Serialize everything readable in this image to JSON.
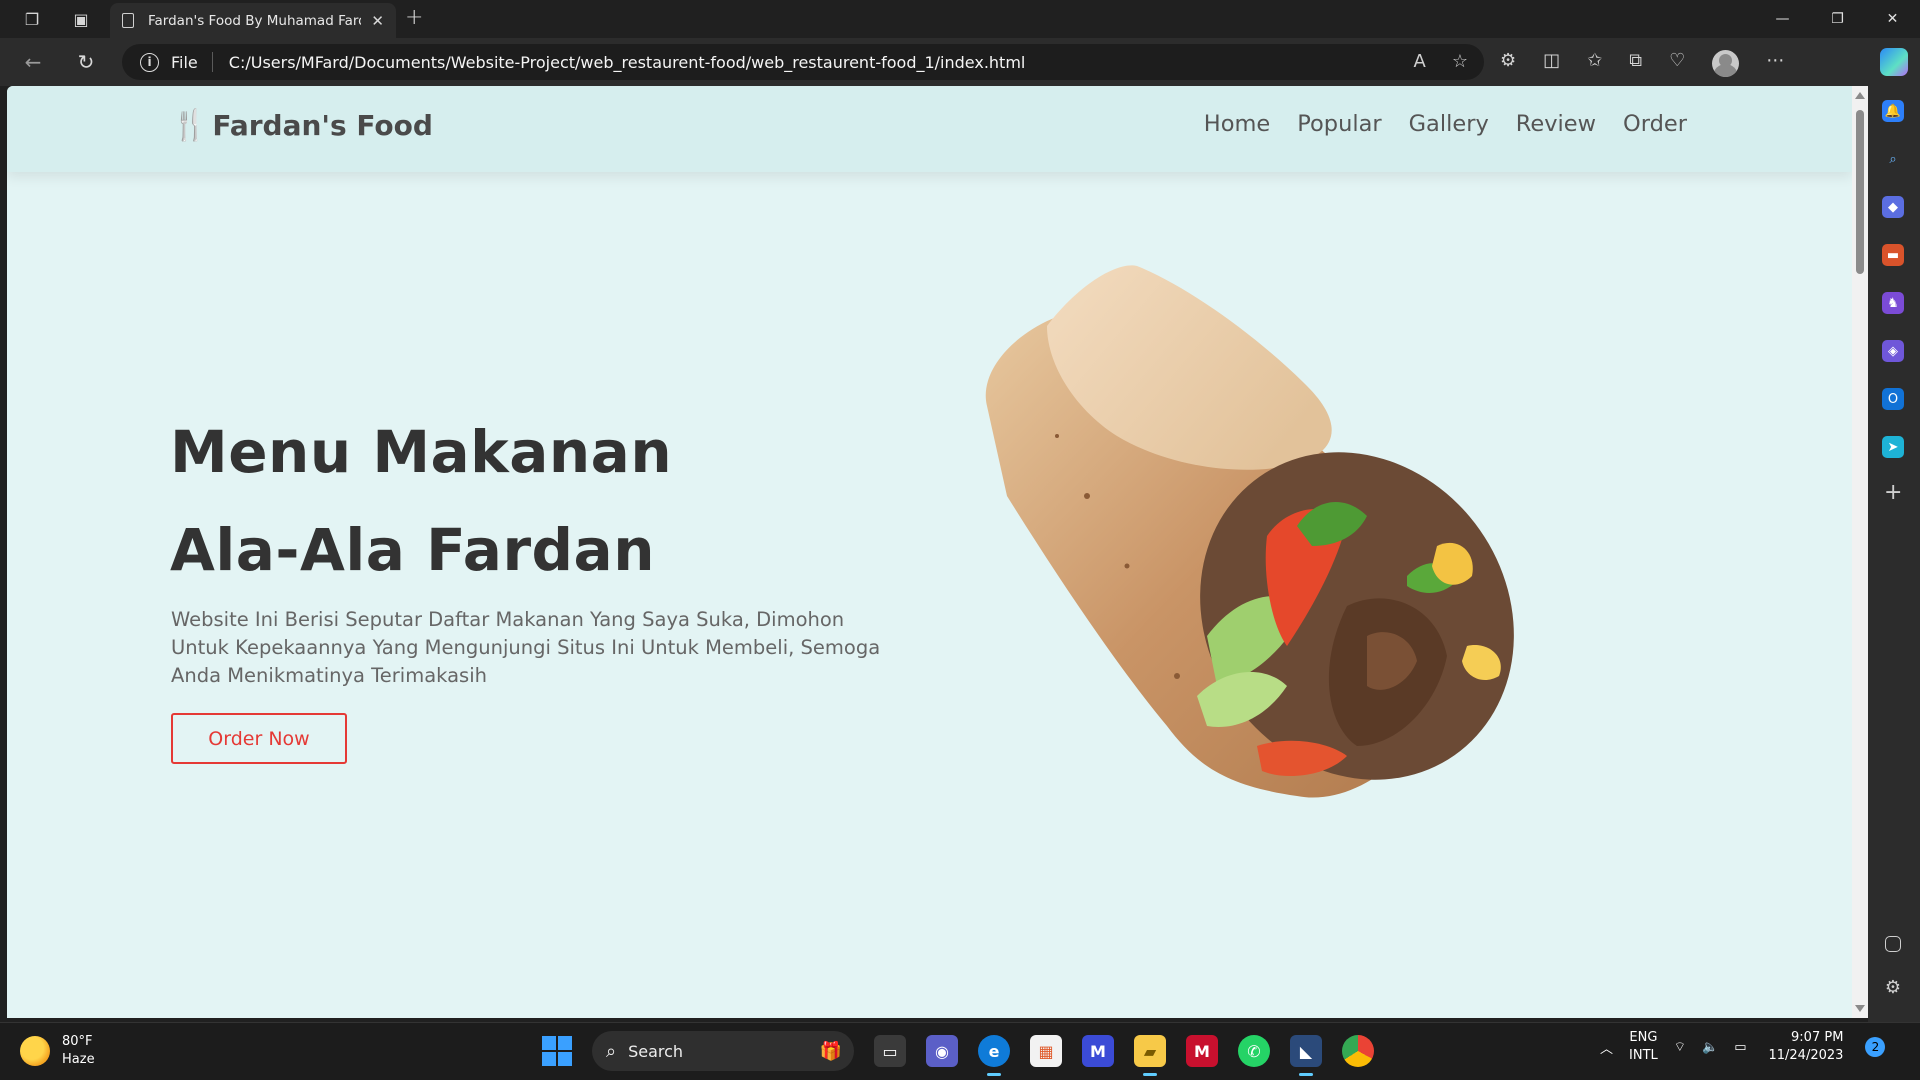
{
  "browser": {
    "tab_title": "Fardan's Food By Muhamad Fardan",
    "url_scheme": "File",
    "url_path": "C:/Users/MFard/Documents/Website-Project/web_restaurent-food/web_restaurent-food_1/index.html"
  },
  "site": {
    "logo_text": "Fardan's Food",
    "nav": [
      "Home",
      "Popular",
      "Gallery",
      "Review",
      "Order"
    ],
    "hero_line1": "Menu Makanan",
    "hero_line2": "Ala-Ala Fardan",
    "hero_description": "Website Ini Berisi Seputar Daftar Makanan Yang Saya Suka, Dimohon Untuk Kepekaannya Yang Mengunjungi Situs Ini Untuk Membeli, Semoga Anda Menikmatinya Terimakasih",
    "order_button": "Order Now",
    "accent_color": "#e53935",
    "background_color": "#e3f4f4"
  },
  "taskbar": {
    "weather_temp": "80°F",
    "weather_desc": "Haze",
    "search_label": "Search",
    "lang_top": "ENG",
    "lang_bottom": "INTL",
    "time": "9:07 PM",
    "date": "11/24/2023",
    "notification_count": "2"
  }
}
